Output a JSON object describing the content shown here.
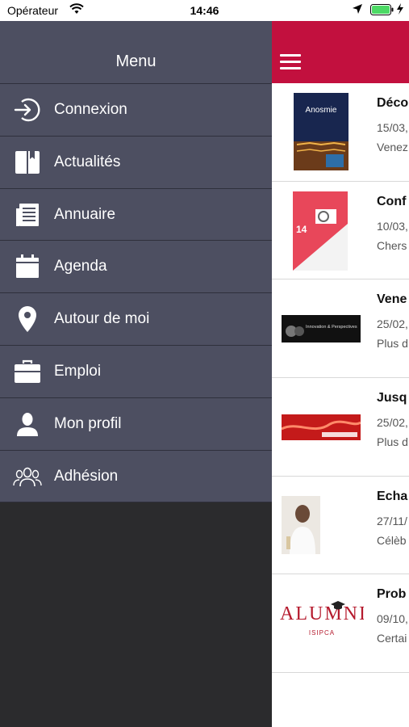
{
  "status_bar": {
    "carrier": "Opérateur",
    "time": "14:46"
  },
  "drawer": {
    "title": "Menu",
    "items": [
      {
        "label": "Connexion",
        "icon": "login-icon"
      },
      {
        "label": "Actualités",
        "icon": "book-icon"
      },
      {
        "label": "Annuaire",
        "icon": "document-icon"
      },
      {
        "label": "Agenda",
        "icon": "calendar-icon"
      },
      {
        "label": "Autour de moi",
        "icon": "location-pin-icon"
      },
      {
        "label": "Emploi",
        "icon": "briefcase-icon"
      },
      {
        "label": "Mon profil",
        "icon": "user-icon"
      },
      {
        "label": "Adhésion",
        "icon": "group-icon"
      }
    ]
  },
  "news": [
    {
      "title": "Déco",
      "date": "15/03,",
      "sub": "Venez",
      "thumb_text": "Anosmie"
    },
    {
      "title": "Conf",
      "date": "10/03,",
      "sub": "Chers",
      "thumb_text": "14"
    },
    {
      "title": "Vene",
      "date": "25/02,",
      "sub": "Plus d",
      "thumb_text": "Innovation & Perspectives"
    },
    {
      "title": "Jusq",
      "date": "25/02,",
      "sub": "Plus d",
      "thumb_text": ""
    },
    {
      "title": "Echa",
      "date": "27/11/",
      "sub": "Célèb",
      "thumb_text": ""
    },
    {
      "title": "Prob",
      "date": "09/10,",
      "sub": "Certai",
      "thumb_text": "ISIPCA"
    }
  ],
  "logo_text": "ALUMNI",
  "colors": {
    "accent": "#c2103e",
    "drawer_bg": "#4d4f61",
    "divider": "#2f303c"
  }
}
